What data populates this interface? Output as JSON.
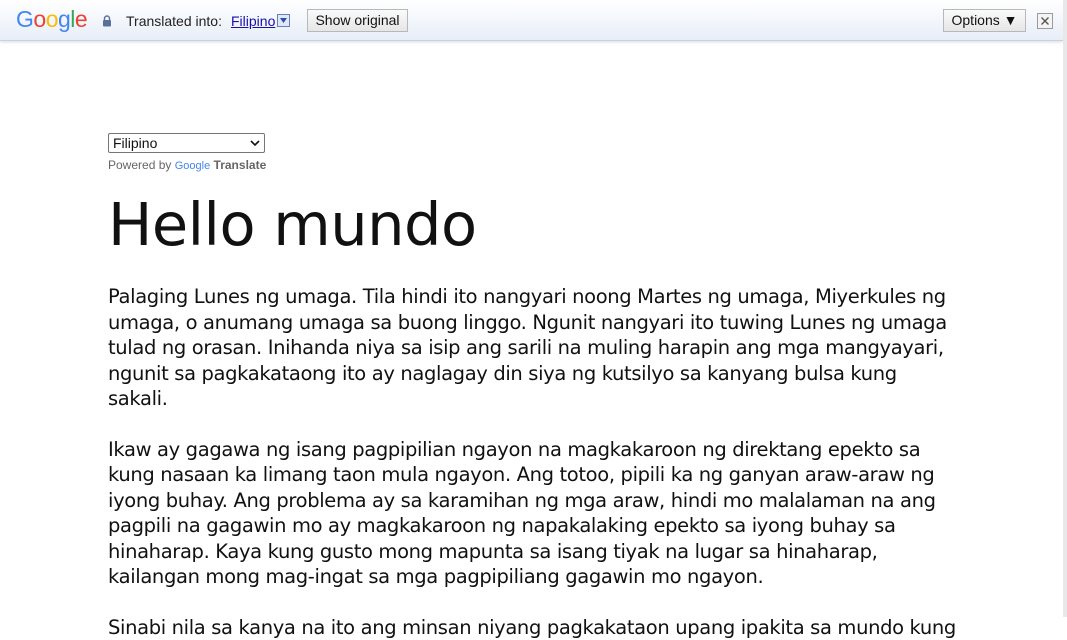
{
  "translate_bar": {
    "logo_letters": [
      {
        "char": "G",
        "color": "#4285F4"
      },
      {
        "char": "o",
        "color": "#EA4335"
      },
      {
        "char": "o",
        "color": "#FBBC05"
      },
      {
        "char": "g",
        "color": "#4285F4"
      },
      {
        "char": "l",
        "color": "#34A853"
      },
      {
        "char": "e",
        "color": "#EA4335"
      }
    ],
    "lock_icon": "lock-icon",
    "translated_into_label": "Translated into:",
    "language_link": "Filipino",
    "show_original_label": "Show original",
    "options_label": "Options ▼",
    "close_icon": "close-icon"
  },
  "page": {
    "language_select_value": "Filipino",
    "powered_by_label": "Powered by",
    "powered_google": "Google",
    "powered_translate": "Translate",
    "heading": "Hello mundo",
    "paragraphs": [
      "Palaging Lunes ng umaga. Tila hindi ito nangyari noong Martes ng umaga, Miyerkules ng umaga, o anumang umaga sa buong linggo. Ngunit nangyari ito tuwing Lunes ng umaga tulad ng orasan. Inihanda niya sa isip ang sarili na muling harapin ang mga mangyayari, ngunit sa pagkakataong ito ay naglagay din siya ng kutsilyo sa kanyang bulsa kung sakali.",
      "Ikaw ay gagawa ng isang pagpipilian ngayon na magkakaroon ng direktang epekto sa kung nasaan ka limang taon mula ngayon. Ang totoo, pipili ka ng ganyan araw-araw ng iyong buhay. Ang problema ay sa karamihan ng mga araw, hindi mo malalaman na ang pagpili na gagawin mo ay magkakaroon ng napakalaking epekto sa iyong buhay sa hinaharap. Kaya kung gusto mong mapunta sa isang tiyak na lugar sa hinaharap, kailangan mong mag-ingat sa mga pagpipiliang gagawin mo ngayon.",
      "Sinabi nila sa kanya na ito ang minsan niyang pagkakataon upang ipakita sa mundo kung"
    ]
  }
}
